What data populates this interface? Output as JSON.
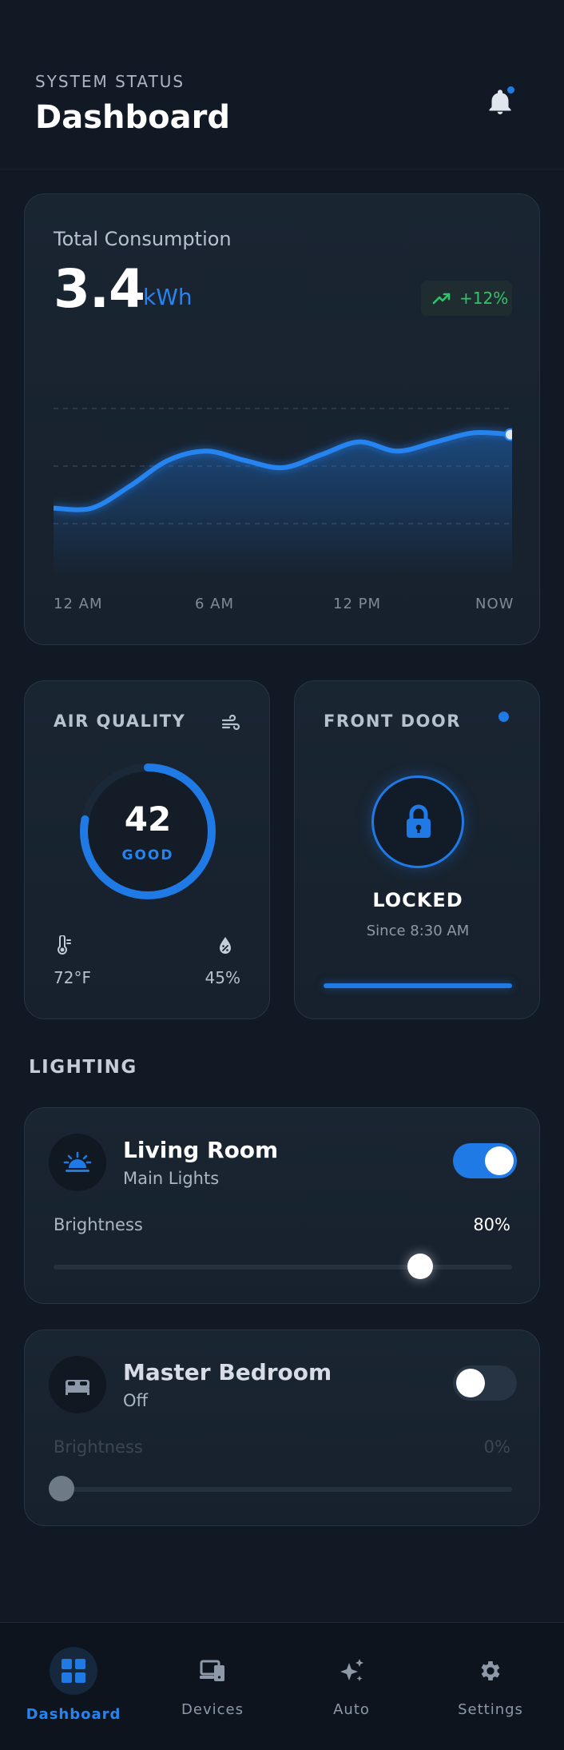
{
  "header": {
    "eyebrow": "SYSTEM STATUS",
    "title": "Dashboard",
    "has_notification": true
  },
  "consumption": {
    "label": "Total Consumption",
    "value": "3.4",
    "unit": "kWh",
    "trend": "+12%",
    "accent_color": "#2584f0",
    "trend_color": "#2fc46c"
  },
  "chart_data": {
    "type": "area",
    "x": [
      "12 AM",
      "6 AM",
      "12 PM",
      "NOW"
    ],
    "values": [
      0.38,
      0.38,
      0.5,
      0.64,
      0.69,
      0.64,
      0.6,
      0.67,
      0.74,
      0.69,
      0.74,
      0.79,
      0.78
    ],
    "grid": "dashed horizontal"
  },
  "air_quality": {
    "title": "AIR QUALITY",
    "score": "42",
    "status": "GOOD",
    "progress": 0.78,
    "temperature": "72°F",
    "humidity": "45%"
  },
  "front_door": {
    "title": "FRONT DOOR",
    "state": "LOCKED",
    "since": "Since 8:30 AM"
  },
  "lighting": {
    "section_title": "LIGHTING",
    "rooms": [
      {
        "name": "Living Room",
        "subtitle": "Main Lights",
        "on": true,
        "brightness_label": "Brightness",
        "brightness": "80%",
        "level": 0.8
      },
      {
        "name": "Master Bedroom",
        "subtitle": "Off",
        "on": false,
        "brightness_label": "Brightness",
        "brightness": "0%",
        "level": 0
      }
    ]
  },
  "nav": {
    "items": [
      {
        "label": "Dashboard",
        "icon": "grid-icon",
        "active": true
      },
      {
        "label": "Devices",
        "icon": "devices-icon",
        "active": false
      },
      {
        "label": "Auto",
        "icon": "sparkles-icon",
        "active": false
      },
      {
        "label": "Settings",
        "icon": "gear-icon",
        "active": false
      }
    ]
  }
}
